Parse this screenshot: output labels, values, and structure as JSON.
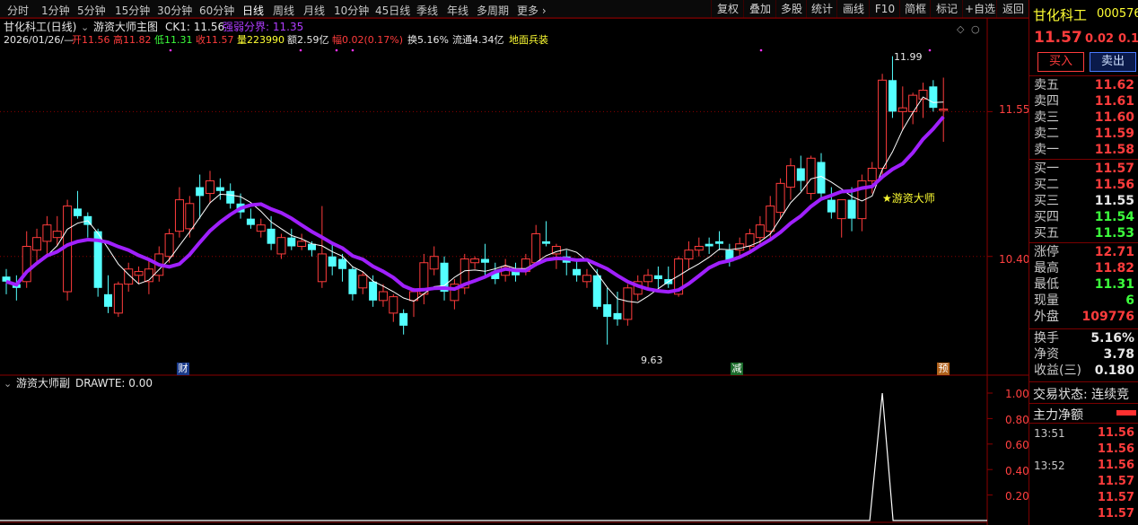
{
  "toolbar": {
    "periods": [
      "分时",
      "1分钟",
      "5分钟",
      "15分钟",
      "30分钟",
      "60分钟",
      "日线",
      "周线",
      "月线",
      "10分钟",
      "45日线",
      "季线",
      "年线",
      "多周期",
      "更多 ›"
    ],
    "active_period": "日线",
    "tools": [
      "复权",
      "叠加",
      "多股",
      "统计",
      "画线",
      "F10",
      "简框",
      "标记",
      "+自选",
      "返回"
    ]
  },
  "main_chart": {
    "stock_title": "甘化科工(日线)",
    "indicator_name": "游资大师主图",
    "ck1": "CK1: 11.56",
    "divider_label": "强弱分界: 11.35",
    "info_date": "2026/01/26/—",
    "info_open": "开11.56",
    "info_high": "高11.82",
    "info_low": "低11.31",
    "info_close": "收11.57",
    "info_volume": "量223990",
    "info_amount": "额2.59亿",
    "info_range": "幅0.02(0.17%)",
    "info_turnover": "换5.16%",
    "info_float": "流通4.34亿",
    "info_concept": "地面兵装",
    "high_marker": "11.99",
    "low_marker": "9.63",
    "signal_label": "★游资大师",
    "y_labels": [
      "11.55",
      "10.40"
    ],
    "event_tags": [
      "财",
      "减",
      "预"
    ]
  },
  "sub_chart": {
    "title": "游资大师副",
    "drawte": "DRAWTE: 0.00",
    "y_labels": [
      "1.00",
      "0.80",
      "0.60",
      "0.40",
      "0.20"
    ]
  },
  "quote_panel": {
    "name": "甘化科工",
    "code": "000576",
    "price": "11.57",
    "change": "0.02",
    "change_pct": "0.1",
    "buy_label": "买入",
    "sell_label": "卖出",
    "asks": [
      {
        "label": "卖五",
        "price": "11.62"
      },
      {
        "label": "卖四",
        "price": "11.61"
      },
      {
        "label": "卖三",
        "price": "11.60"
      },
      {
        "label": "卖二",
        "price": "11.59"
      },
      {
        "label": "卖一",
        "price": "11.58"
      }
    ],
    "bids": [
      {
        "label": "买一",
        "price": "11.57"
      },
      {
        "label": "买二",
        "price": "11.56"
      },
      {
        "label": "买三",
        "price": "11.55"
      },
      {
        "label": "买四",
        "price": "11.54"
      },
      {
        "label": "买五",
        "price": "11.53"
      }
    ],
    "stats": [
      {
        "label": "涨停",
        "value": "12.71"
      },
      {
        "label": "最高",
        "value": "11.82"
      },
      {
        "label": "最低",
        "value": "11.31"
      },
      {
        "label": "现量",
        "value": "6"
      },
      {
        "label": "外盘",
        "value": "109776"
      }
    ],
    "stats2": [
      {
        "label": "换手",
        "value": "5.16%"
      },
      {
        "label": "净资",
        "value": "3.78"
      },
      {
        "label": "收益(三)",
        "value": "0.180"
      }
    ],
    "trade_status": "交易状态: 连续竞",
    "net_flow": "主力净额",
    "ticks": [
      {
        "time": "13:51",
        "price": "11.56"
      },
      {
        "time": "",
        "price": "11.56"
      },
      {
        "time": "13:52",
        "price": "11.56"
      },
      {
        "time": "",
        "price": "11.57"
      },
      {
        "time": "",
        "price": "11.57"
      },
      {
        "time": "",
        "price": "11.57"
      }
    ]
  },
  "colors": {
    "up": "#ff3c3c",
    "down": "#54ffff",
    "ma": "#a020ff",
    "ck": "#ffffff",
    "grid": "#8b0000"
  },
  "chart_data": {
    "type": "candlestick",
    "ohlc": [
      [
        10.24,
        10.3,
        10.1,
        10.2
      ],
      [
        10.18,
        10.25,
        10.05,
        10.15
      ],
      [
        10.2,
        10.6,
        10.15,
        10.48
      ],
      [
        10.45,
        10.62,
        10.35,
        10.55
      ],
      [
        10.52,
        10.72,
        10.4,
        10.65
      ],
      [
        10.55,
        10.72,
        10.48,
        10.6
      ],
      [
        10.12,
        10.85,
        10.05,
        10.8
      ],
      [
        10.78,
        10.92,
        10.7,
        10.72
      ],
      [
        10.72,
        10.75,
        10.55,
        10.65
      ],
      [
        10.6,
        10.62,
        10.08,
        10.15
      ],
      [
        10.1,
        10.25,
        9.95,
        10.0
      ],
      [
        9.95,
        10.2,
        9.92,
        10.18
      ],
      [
        10.18,
        10.35,
        10.12,
        10.3
      ],
      [
        10.25,
        10.32,
        10.18,
        10.28
      ],
      [
        10.2,
        10.38,
        10.1,
        10.3
      ],
      [
        10.25,
        10.48,
        10.2,
        10.42
      ],
      [
        10.4,
        10.62,
        10.35,
        10.58
      ],
      [
        10.6,
        10.95,
        10.55,
        10.85
      ],
      [
        10.62,
        10.88,
        10.55,
        10.82
      ],
      [
        10.95,
        11.05,
        10.7,
        10.88
      ],
      [
        10.9,
        11.08,
        10.82,
        11.0
      ],
      [
        10.95,
        11.02,
        10.85,
        10.92
      ],
      [
        10.92,
        10.98,
        10.78,
        10.82
      ],
      [
        10.82,
        10.9,
        10.7,
        10.75
      ],
      [
        10.7,
        10.78,
        10.62,
        10.65
      ],
      [
        10.6,
        10.7,
        10.55,
        10.65
      ],
      [
        10.62,
        10.72,
        10.45,
        10.5
      ],
      [
        10.42,
        10.58,
        10.38,
        10.55
      ],
      [
        10.55,
        10.62,
        10.45,
        10.48
      ],
      [
        10.48,
        10.58,
        10.45,
        10.52
      ],
      [
        10.5,
        10.52,
        10.4,
        10.45
      ],
      [
        10.2,
        10.8,
        10.15,
        10.42
      ],
      [
        10.4,
        10.5,
        10.25,
        10.32
      ],
      [
        10.38,
        10.42,
        10.2,
        10.3
      ],
      [
        10.3,
        10.32,
        10.05,
        10.1
      ],
      [
        10.15,
        10.28,
        10.1,
        10.25
      ],
      [
        10.2,
        10.25,
        10.0,
        10.05
      ],
      [
        10.05,
        10.18,
        10.0,
        10.12
      ],
      [
        9.95,
        10.1,
        9.88,
        10.08
      ],
      [
        9.95,
        9.98,
        9.78,
        9.85
      ],
      [
        10.05,
        10.15,
        9.92,
        10.12
      ],
      [
        10.1,
        10.42,
        10.02,
        10.35
      ],
      [
        10.3,
        10.48,
        10.25,
        10.4
      ],
      [
        10.35,
        10.4,
        10.05,
        10.12
      ],
      [
        10.05,
        10.22,
        9.98,
        10.18
      ],
      [
        10.15,
        10.42,
        10.1,
        10.38
      ],
      [
        10.35,
        10.4,
        10.3,
        10.38
      ],
      [
        10.38,
        10.5,
        10.25,
        10.35
      ],
      [
        10.28,
        10.35,
        10.18,
        10.22
      ],
      [
        10.25,
        10.38,
        10.2,
        10.32
      ],
      [
        10.3,
        10.35,
        10.2,
        10.25
      ],
      [
        10.28,
        10.42,
        10.25,
        10.38
      ],
      [
        10.35,
        10.65,
        10.32,
        10.58
      ],
      [
        10.52,
        10.68,
        10.48,
        10.5
      ],
      [
        10.42,
        10.5,
        10.3,
        10.48
      ],
      [
        10.4,
        10.45,
        10.25,
        10.35
      ],
      [
        10.3,
        10.38,
        10.2,
        10.25
      ],
      [
        10.2,
        10.3,
        10.15,
        10.25
      ],
      [
        10.25,
        10.3,
        9.98,
        10.0
      ],
      [
        10.02,
        10.15,
        9.7,
        9.92
      ],
      [
        9.95,
        10.12,
        9.85,
        9.9
      ],
      [
        9.9,
        10.18,
        9.85,
        10.15
      ],
      [
        10.1,
        10.25,
        10.05,
        10.2
      ],
      [
        10.2,
        10.3,
        10.15,
        10.25
      ],
      [
        10.25,
        10.32,
        10.15,
        10.22
      ],
      [
        10.22,
        10.32,
        10.15,
        10.18
      ],
      [
        10.1,
        10.4,
        10.08,
        10.38
      ],
      [
        10.38,
        10.52,
        10.3,
        10.45
      ],
      [
        10.45,
        10.55,
        10.4,
        10.48
      ],
      [
        10.5,
        10.55,
        10.42,
        10.48
      ],
      [
        10.52,
        10.6,
        10.45,
        10.5
      ],
      [
        10.45,
        10.5,
        10.32,
        10.36
      ],
      [
        10.45,
        10.55,
        10.4,
        10.5
      ],
      [
        10.48,
        10.62,
        10.45,
        10.58
      ],
      [
        10.55,
        10.72,
        10.5,
        10.65
      ],
      [
        10.6,
        10.88,
        10.55,
        10.8
      ],
      [
        10.75,
        11.02,
        10.7,
        10.98
      ],
      [
        10.95,
        11.18,
        10.85,
        11.12
      ],
      [
        11.1,
        11.2,
        10.92,
        11.0
      ],
      [
        10.9,
        11.2,
        10.85,
        11.18
      ],
      [
        11.15,
        11.22,
        10.85,
        10.9
      ],
      [
        10.85,
        10.95,
        10.7,
        10.75
      ],
      [
        10.7,
        10.78,
        10.55,
        10.85
      ],
      [
        10.85,
        10.95,
        10.6,
        10.7
      ],
      [
        10.7,
        11.05,
        10.6,
        11.0
      ],
      [
        11.0,
        11.15,
        10.9,
        11.1
      ],
      [
        11.1,
        11.85,
        11.05,
        11.8
      ],
      [
        11.8,
        11.99,
        11.5,
        11.55
      ],
      [
        11.55,
        11.75,
        11.4,
        11.58
      ],
      [
        11.55,
        11.7,
        11.45,
        11.68
      ],
      [
        11.65,
        11.78,
        11.5,
        11.72
      ],
      [
        11.75,
        11.8,
        11.55,
        11.58
      ],
      [
        11.56,
        11.82,
        11.31,
        11.57
      ]
    ],
    "y_ticks": [
      11.55,
      10.4
    ],
    "sub_values_peak": 1.0,
    "sub_ylim": [
      0,
      1.0
    ]
  }
}
